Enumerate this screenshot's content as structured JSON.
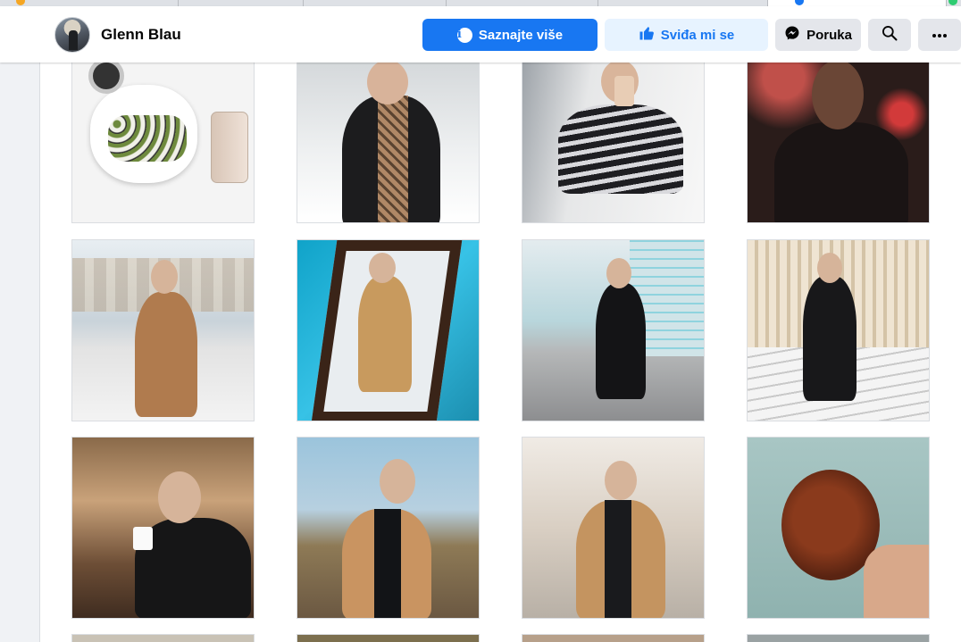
{
  "header": {
    "page_name": "Glenn Blau",
    "learn_more_label": "Saznajte više",
    "like_label": "Sviđa mi se",
    "message_label": "Poruka"
  },
  "icons": {
    "info": "info-icon",
    "like": "thumbs-up-icon",
    "messenger": "messenger-icon",
    "search": "search-icon",
    "more": "more-icon"
  },
  "colors": {
    "primary": "#1877f2",
    "like_bg": "#e7f3ff",
    "secondary_bg": "#e4e6eb"
  },
  "photos": {
    "count_visible_rows": 3,
    "columns": 4
  }
}
